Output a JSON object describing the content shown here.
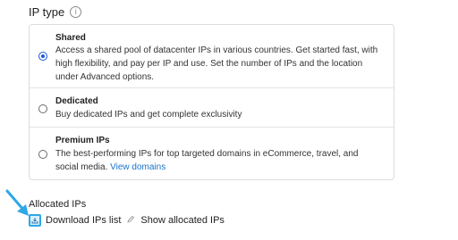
{
  "ip_type": {
    "title": "IP type",
    "info_icon": "info-icon"
  },
  "options": [
    {
      "title": "Shared",
      "selected": true,
      "description": "Access a shared pool of datacenter IPs in various countries. Get started fast, with high flexibility, and pay per IP and use. Set the number of IPs and the location under Advanced options."
    },
    {
      "title": "Dedicated",
      "selected": false,
      "description": "Buy dedicated IPs and get complete exclusivity"
    },
    {
      "title": "Premium IPs",
      "selected": false,
      "description": "The best-performing IPs for top targeted domains in eCommerce, travel, and social media.",
      "link": "View domains"
    }
  ],
  "allocated": {
    "title": "Allocated IPs",
    "download_label": "Download IPs list",
    "show_label": "Show allocated IPs"
  },
  "colors": {
    "accent": "#1a56db",
    "highlight": "#2ea8e6",
    "link": "#1a73c8"
  }
}
